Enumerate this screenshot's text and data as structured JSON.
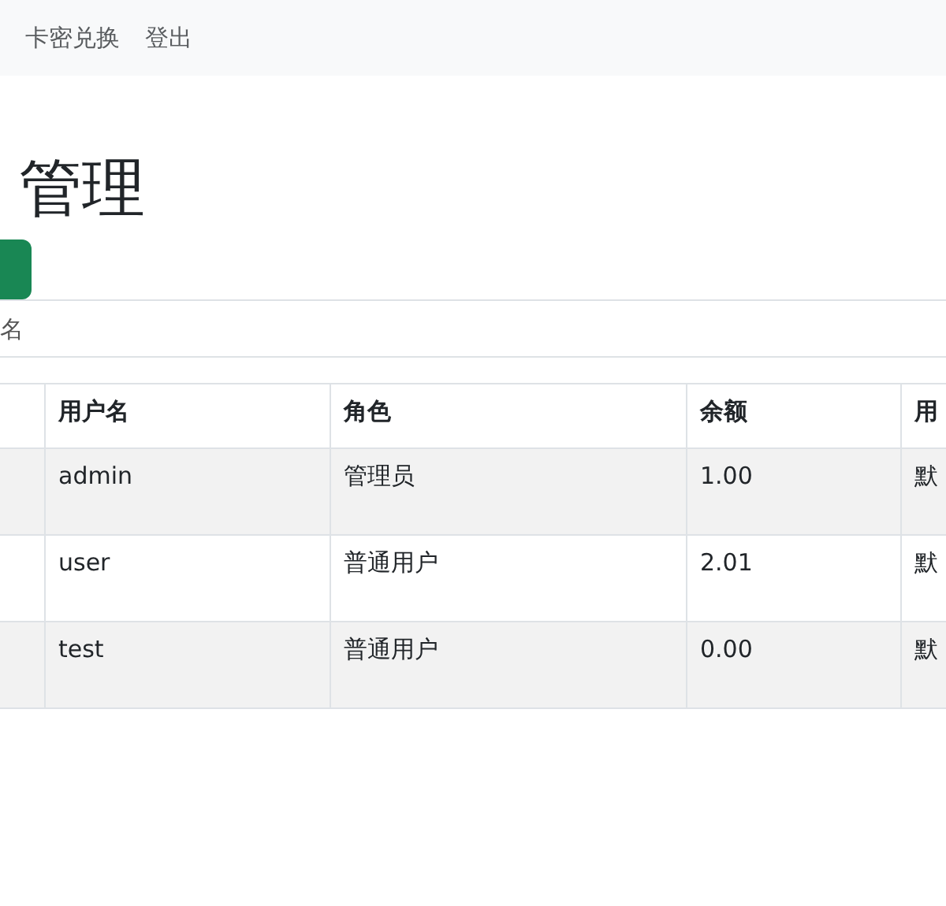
{
  "navbar": {
    "links": [
      "卡密兑换",
      "登出"
    ]
  },
  "page_title": "管理",
  "search": {
    "placeholder": "名"
  },
  "table": {
    "columns": [
      "用户名",
      "角色",
      "余额",
      "用"
    ],
    "rows": [
      {
        "cells": [
          "admin",
          "管理员",
          "1.00",
          "默"
        ]
      },
      {
        "cells": [
          "user",
          "普通用户",
          "2.01",
          "默"
        ]
      },
      {
        "cells": [
          "test",
          "普通用户",
          "0.00",
          "默"
        ]
      }
    ]
  }
}
